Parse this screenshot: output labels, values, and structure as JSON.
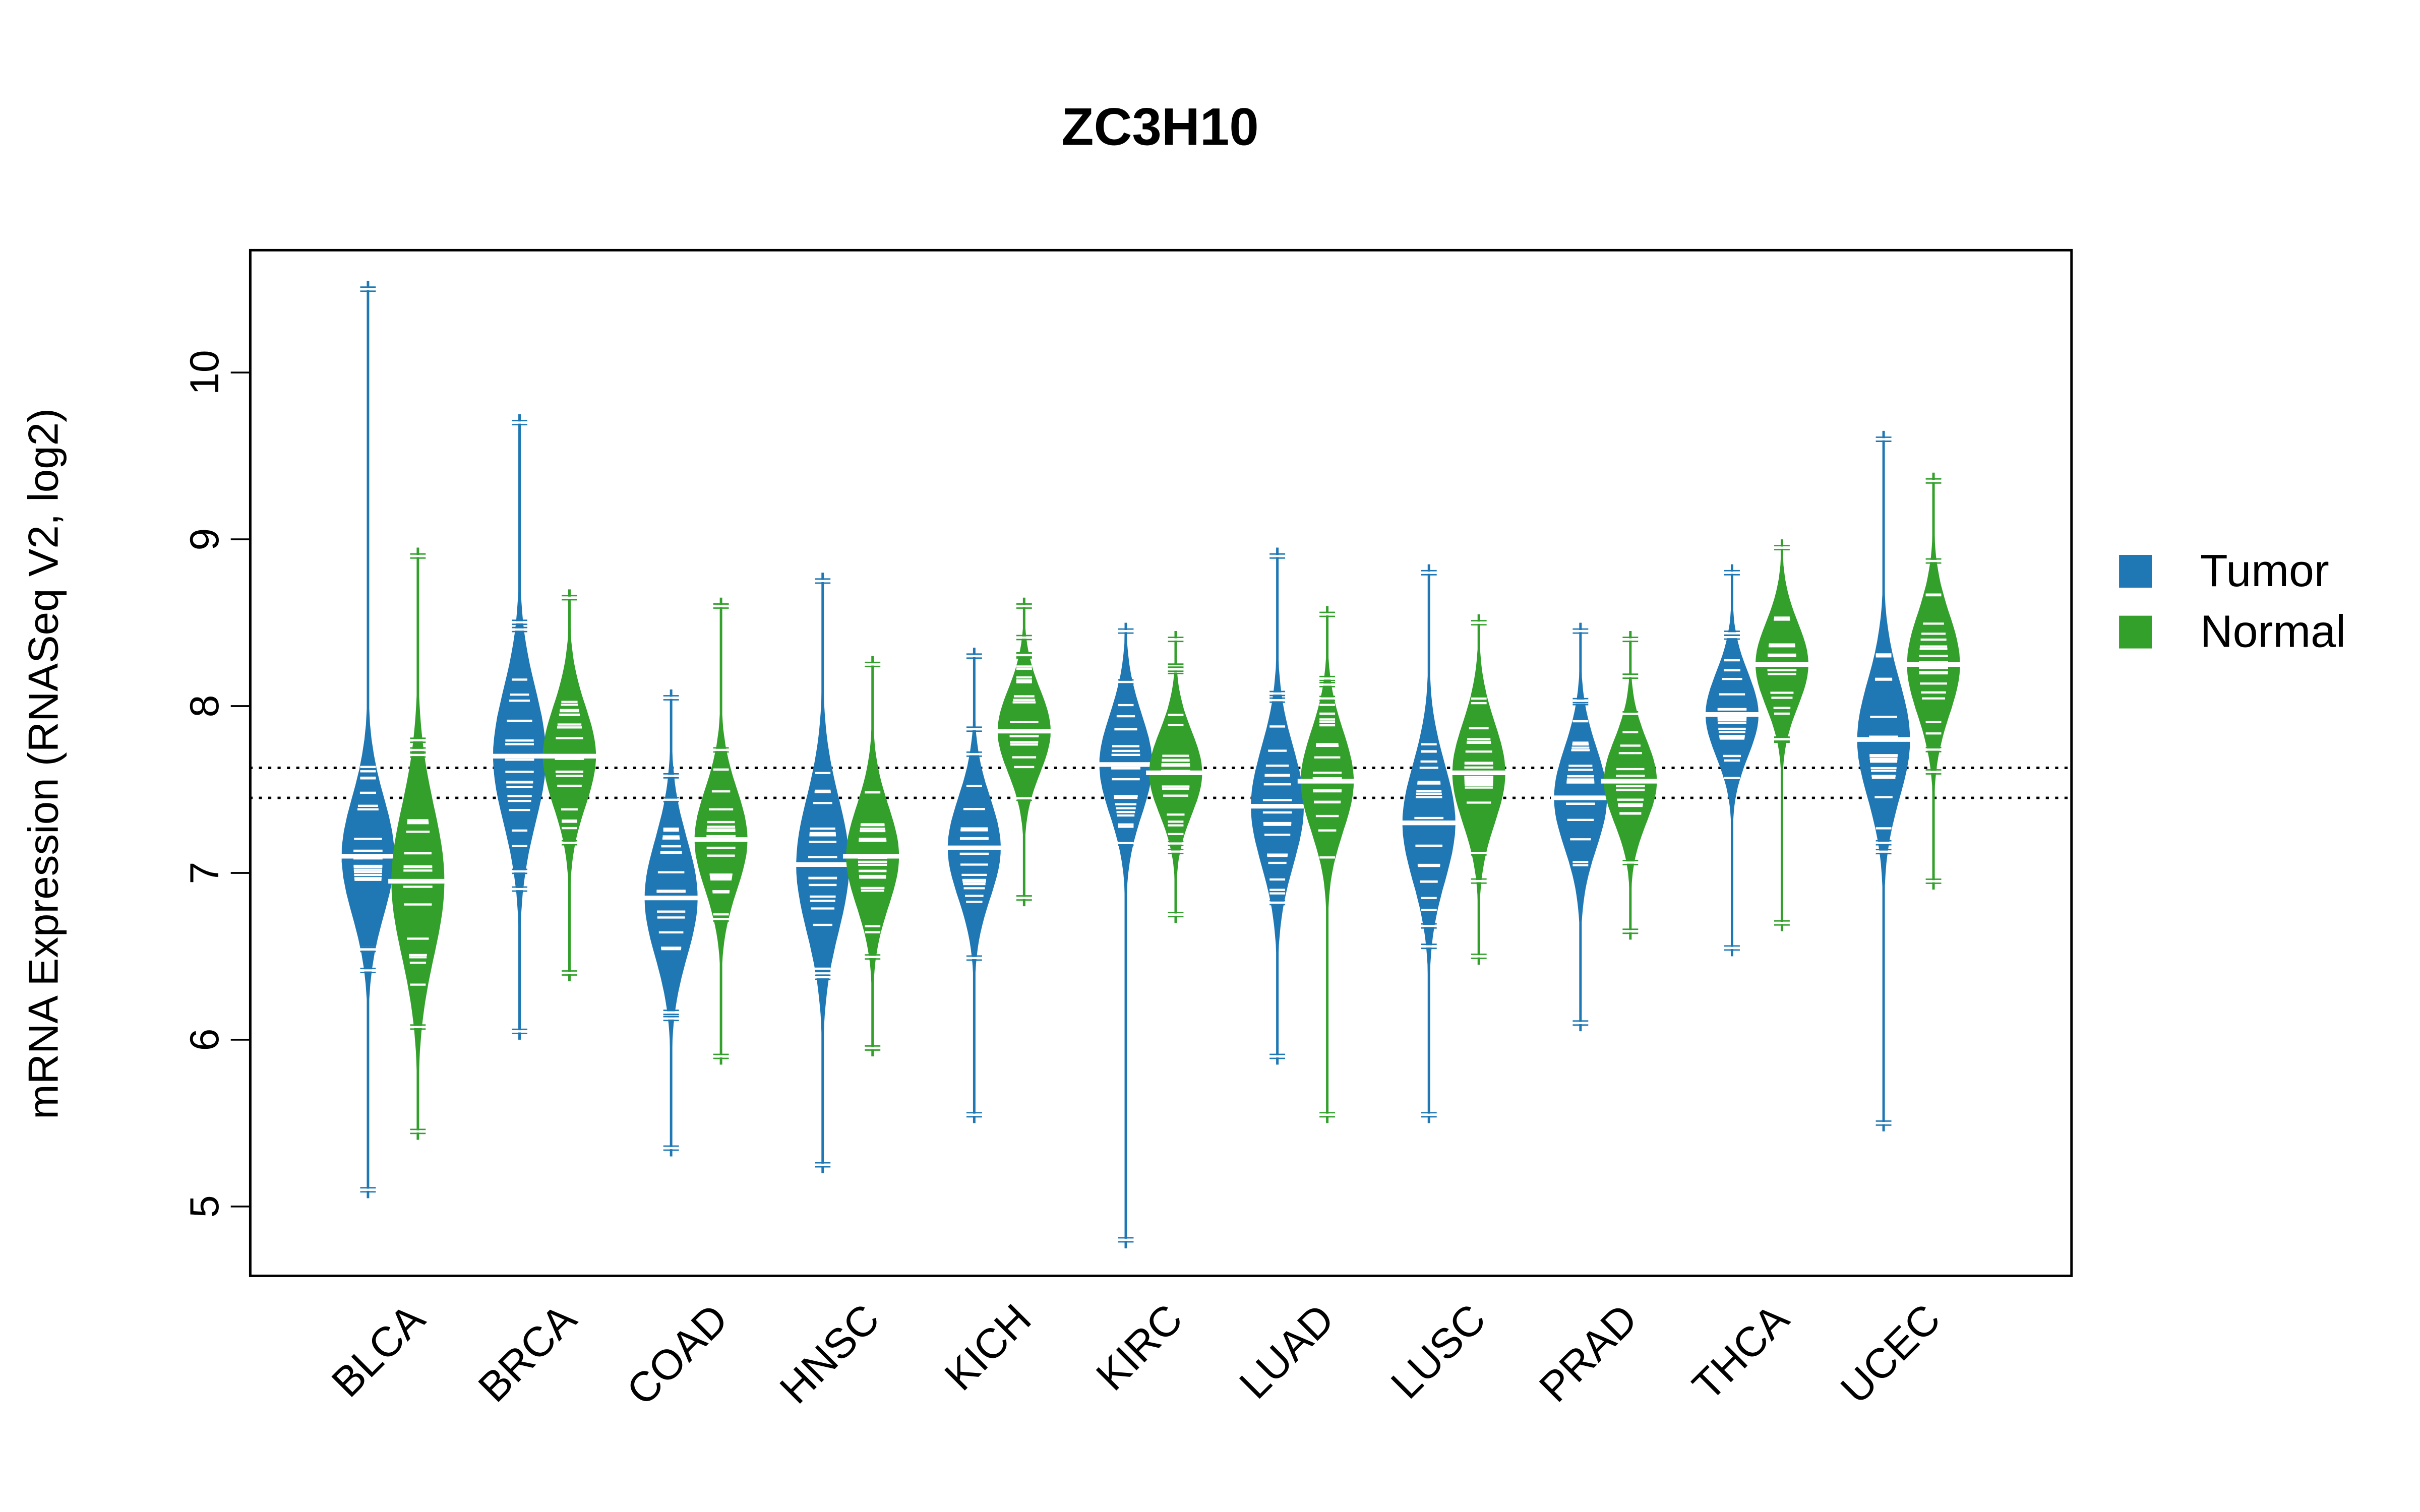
{
  "chart_data": {
    "type": "beanplot",
    "title": "ZC3H10",
    "xlabel": "",
    "ylabel": "mRNA Expression (RNASeq V2, log2)",
    "ylim": [
      4.6,
      10.75
    ],
    "yticks": [
      5,
      6,
      7,
      8,
      9,
      10
    ],
    "ytick_labels": [
      "5",
      "6",
      "7",
      "8",
      "9",
      "10"
    ],
    "grid": false,
    "legend": {
      "placement": "right",
      "entries": [
        {
          "name": "Tumor",
          "color": "#1f78b4"
        },
        {
          "name": "Normal",
          "color": "#33a02c"
        }
      ]
    },
    "reference_lines": [
      {
        "value": 7.63,
        "style": "dotted",
        "label": ""
      },
      {
        "value": 7.45,
        "style": "dotted",
        "label": ""
      }
    ],
    "categories": [
      "BLCA",
      "BRCA",
      "COAD",
      "HNSC",
      "KICH",
      "KIRC",
      "LUAD",
      "LUSC",
      "PRAD",
      "THCA",
      "UCEC"
    ],
    "series": [
      {
        "name": "Tumor",
        "color": "#1f78b4",
        "median": [
          7.1,
          7.7,
          6.85,
          7.05,
          7.15,
          7.65,
          7.4,
          7.3,
          7.45,
          7.95,
          7.8
        ],
        "min": [
          5.1,
          6.05,
          5.35,
          5.25,
          5.55,
          4.8,
          5.9,
          5.55,
          6.1,
          6.55,
          5.5
        ],
        "max": [
          10.5,
          9.7,
          8.05,
          8.75,
          8.3,
          8.45,
          8.9,
          8.8,
          8.45,
          8.8,
          9.6
        ],
        "spread": [
          0.35,
          0.4,
          0.35,
          0.4,
          0.3,
          0.3,
          0.35,
          0.35,
          0.3,
          0.25,
          0.35
        ]
      },
      {
        "name": "Normal",
        "color": "#33a02c",
        "median": [
          6.95,
          7.7,
          7.2,
          7.1,
          7.85,
          7.6,
          7.55,
          7.6,
          7.55,
          8.25,
          8.25
        ],
        "min": [
          5.45,
          6.4,
          5.9,
          5.95,
          6.85,
          6.75,
          5.55,
          6.5,
          6.65,
          6.7,
          6.95
        ],
        "max": [
          8.9,
          8.65,
          8.6,
          8.25,
          8.6,
          8.4,
          8.55,
          8.5,
          8.4,
          8.95,
          9.35
        ],
        "spread": [
          0.45,
          0.3,
          0.3,
          0.3,
          0.25,
          0.25,
          0.3,
          0.3,
          0.25,
          0.25,
          0.3
        ]
      }
    ]
  }
}
